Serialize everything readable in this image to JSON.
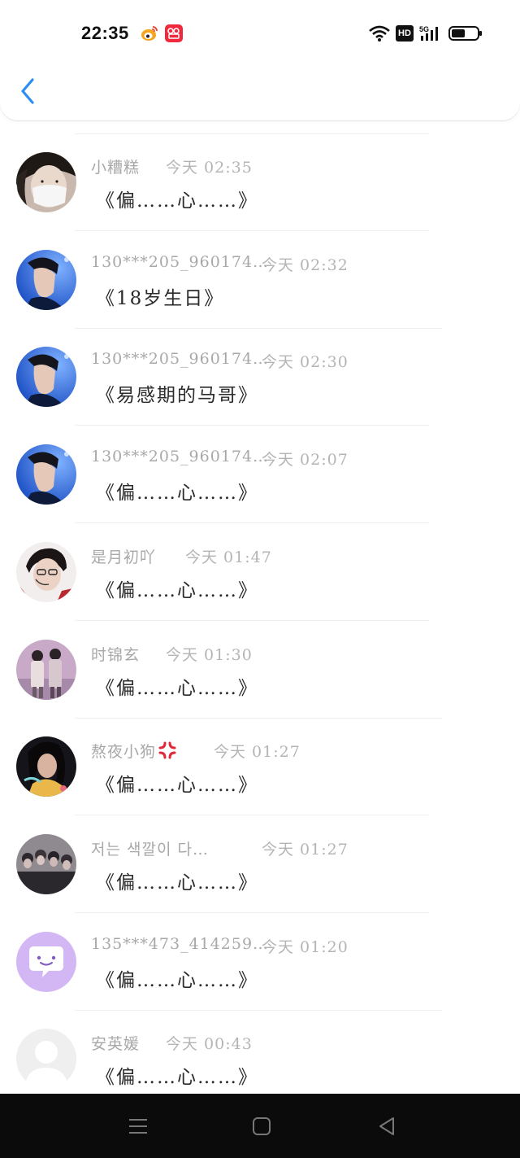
{
  "status_bar": {
    "time": "22:35",
    "apps": [
      "weibo-icon",
      "video-app-icon"
    ],
    "system": {
      "hd_label": "HD",
      "network": "5G",
      "icons": [
        "wifi-icon",
        "hd-icon",
        "signal-icon",
        "battery-icon"
      ]
    }
  },
  "header": {
    "back_icon": "chevron-left-icon",
    "accent_color": "#2c8df4"
  },
  "comments": [
    {
      "name": "小糟糕",
      "time": "今天 02:35",
      "title": "《偏……心……》",
      "avatar": "photo-masked-girl"
    },
    {
      "name": "130***205_960174…",
      "time": "今天 02:32",
      "title": "《18岁生日》",
      "avatar": "photo-boy-blue"
    },
    {
      "name": "130***205_960174…",
      "time": "今天 02:30",
      "title": "《易感期的马哥》",
      "avatar": "photo-boy-blue"
    },
    {
      "name": "130***205_960174…",
      "time": "今天 02:07",
      "title": "《偏……心……》",
      "avatar": "photo-boy-blue"
    },
    {
      "name": "是月初吖",
      "time": "今天 01:47",
      "title": "《偏……心……》",
      "avatar": "photo-boy-mic"
    },
    {
      "name": "时锦玄",
      "time": "今天 01:30",
      "title": "《偏……心……》",
      "avatar": "photo-two-boys"
    },
    {
      "name": "熬夜小狗",
      "time": "今天 01:27",
      "title": "《偏……心……》",
      "avatar": "photo-girl-dark",
      "emoji": "anger-symbol-icon"
    },
    {
      "name": "저는 색깔이 다…",
      "time": "今天 01:27",
      "title": "《偏……心……》",
      "avatar": "photo-group"
    },
    {
      "name": "135***473_414259…",
      "time": "今天 01:20",
      "title": "《偏……心……》",
      "avatar": "chat-bubble-icon"
    },
    {
      "name": "安英媛",
      "time": "今天 00:43",
      "title": "《偏……心……》",
      "avatar": "default-avatar-icon"
    }
  ],
  "nav_bar": {
    "icons": [
      "menu-icon",
      "home-icon",
      "back-triangle-icon"
    ]
  }
}
